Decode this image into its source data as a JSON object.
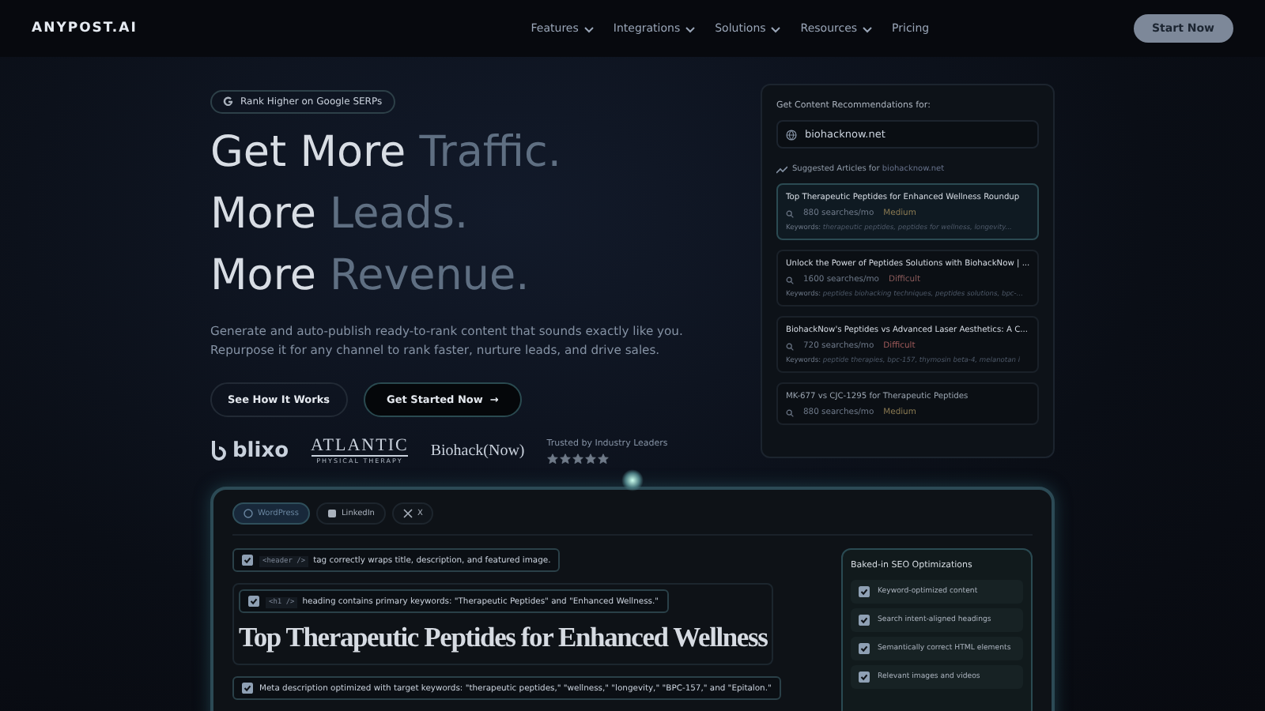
{
  "nav": {
    "logo": "ANYPOST.AI",
    "items": [
      {
        "label": "Features",
        "dropdown": true
      },
      {
        "label": "Integrations",
        "dropdown": true
      },
      {
        "label": "Solutions",
        "dropdown": true
      },
      {
        "label": "Resources",
        "dropdown": true
      },
      {
        "label": "Pricing",
        "dropdown": false
      }
    ],
    "cta": "Start Now"
  },
  "hero": {
    "badge": "Rank Higher on Google SERPs",
    "headline": [
      {
        "lead": "Get More",
        "accent": "Traffic."
      },
      {
        "lead": "More",
        "accent": "Leads."
      },
      {
        "lead": "More",
        "accent": "Revenue."
      }
    ],
    "description": "Generate and auto-publish ready-to-rank content that sounds exactly like you. Repurpose it for any channel to rank faster, nurture leads, and drive sales.",
    "buttons": [
      {
        "label": "See How It Works",
        "kind": "outline"
      },
      {
        "label": "Get Started Now",
        "kind": "primary",
        "arrow": "→"
      }
    ],
    "logos": [
      {
        "kind": "blixo",
        "name": "blixo"
      },
      {
        "kind": "atlantic",
        "name": "ATLANTIC",
        "tagline": "PHYSICAL THERAPY"
      },
      {
        "kind": "biohack",
        "name": "Biohack(Now)"
      }
    ],
    "trust": {
      "label": "Trusted by Industry Leaders",
      "stars": 5
    }
  },
  "recommendations": {
    "title": "Get Content Recommendations for:",
    "domain": "biohacknow.net",
    "suggested_label": "Suggested Articles for",
    "suggested_domain": "biohacknow.net",
    "articles": [
      {
        "title": "Top Therapeutic Peptides for Enhanced Wellness Roundup",
        "searches": "880 searches/mo",
        "difficulty": "Medium",
        "color": "#8a7a52",
        "keywords_label": "Keywords:",
        "keywords": "therapeutic peptides, peptides for wellness, longevity...",
        "selected": true
      },
      {
        "title": "Unlock the Power of Peptides Solutions with BiohackNow | ...",
        "searches": "1600 searches/mo",
        "difficulty": "Difficult",
        "color": "#8a5a5a",
        "keywords_label": "Keywords:",
        "keywords": "peptides biohacking techniques, peptides solutions, bpc-...",
        "selected": false
      },
      {
        "title": "BiohackNow's Peptides vs Advanced Laser Aesthetics: A C...",
        "searches": "720 searches/mo",
        "difficulty": "Difficult",
        "color": "#a05a5a",
        "keywords_label": "Keywords:",
        "keywords": "peptide therapies, bpc-157, thymosin beta-4, melanotan i",
        "selected": false
      },
      {
        "title": "MK-677 vs CJC-1295 for Therapeutic Peptides",
        "searches": "880 searches/mo",
        "difficulty": "Medium",
        "color": "#8a7a52",
        "selected": false
      }
    ]
  },
  "preview": {
    "tabs": [
      {
        "label": "WordPress",
        "selected": true
      },
      {
        "label": "LinkedIn",
        "selected": false
      },
      {
        "label": "X",
        "selected": false
      }
    ],
    "checks": [
      {
        "code": "<header />",
        "text": "tag correctly wraps title, description, and featured image.",
        "checked": true
      },
      {
        "code": "<h1 />",
        "text": "heading contains primary keywords: \"Therapeutic Peptides\" and \"Enhanced Wellness.\"",
        "checked": true
      },
      {
        "text": "Meta description optimized with target keywords: \"therapeutic peptides,\" \"wellness,\" \"longevity,\" \"BPC-157,\" and \"Epitalon.\"",
        "checked": true
      }
    ],
    "title": "Top Therapeutic Peptides for Enhanced Wellness",
    "seo": {
      "title": "Baked-in SEO Optimizations",
      "items": [
        {
          "label": "Keyword-optimized content",
          "checked": true
        },
        {
          "label": "Search intent-aligned headings",
          "checked": true
        },
        {
          "label": "Semantically correct HTML elements",
          "checked": true
        },
        {
          "label": "Relevant images and videos",
          "checked": true
        }
      ]
    }
  }
}
